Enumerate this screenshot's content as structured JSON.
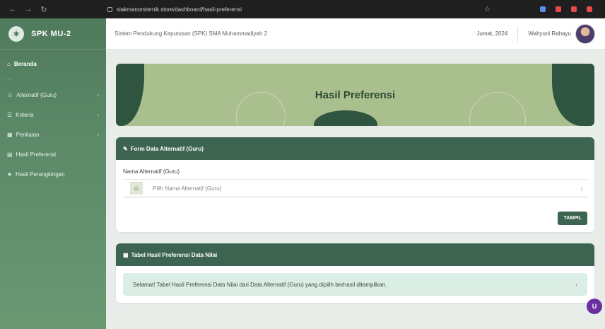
{
  "browser": {
    "url_text": "siakmanorstemik.store/dashboard/hasil-preferensi",
    "extension_colors": [
      "#5b8def",
      "#e84a4a",
      "#e84a4a",
      "#e84a4a"
    ]
  },
  "sidebar": {
    "brand": "SPK MU-2",
    "items": [
      {
        "label": "Beranda",
        "active": true,
        "chevron": false
      },
      {
        "label": "Alternatif (Guru)",
        "active": false,
        "chevron": true
      },
      {
        "label": "Kriteria",
        "active": false,
        "chevron": true
      },
      {
        "label": "Penilaian",
        "active": false,
        "chevron": true
      },
      {
        "label": "Hasil Preferensi",
        "active": false,
        "chevron": false
      },
      {
        "label": "Hasil Perangkingan",
        "active": false,
        "chevron": false
      }
    ]
  },
  "topbar": {
    "breadcrumb": "Sistem Pendukung Keputusan (SPK) SMA Muhammadiyah 2",
    "date": "Jumat, 2024",
    "user": "Wahyuni Rahayu"
  },
  "hero": {
    "title": "Hasil Preferensi"
  },
  "form_card": {
    "title": "Form Data Alternatif (Guru)",
    "field_label": "Nama Alternatif (Guru)",
    "select_placeholder": "Pilih Nama Alternatif (Guru)",
    "submit_label": "TAMPIL"
  },
  "table_card": {
    "title": "Tabel Hasil Preferensi Data Nilai",
    "alert_text": "Selamat! Tabel Hasil Preferensi Data Nilai dari Data Alternatif (Guru) yang dipilih berhasil ditampilkan."
  },
  "floating_button": "U",
  "colors": {
    "sidebar": "#5c8a68",
    "card_header": "#3d6450",
    "hero": "#a9c08e",
    "alert": "#dbeee6"
  }
}
